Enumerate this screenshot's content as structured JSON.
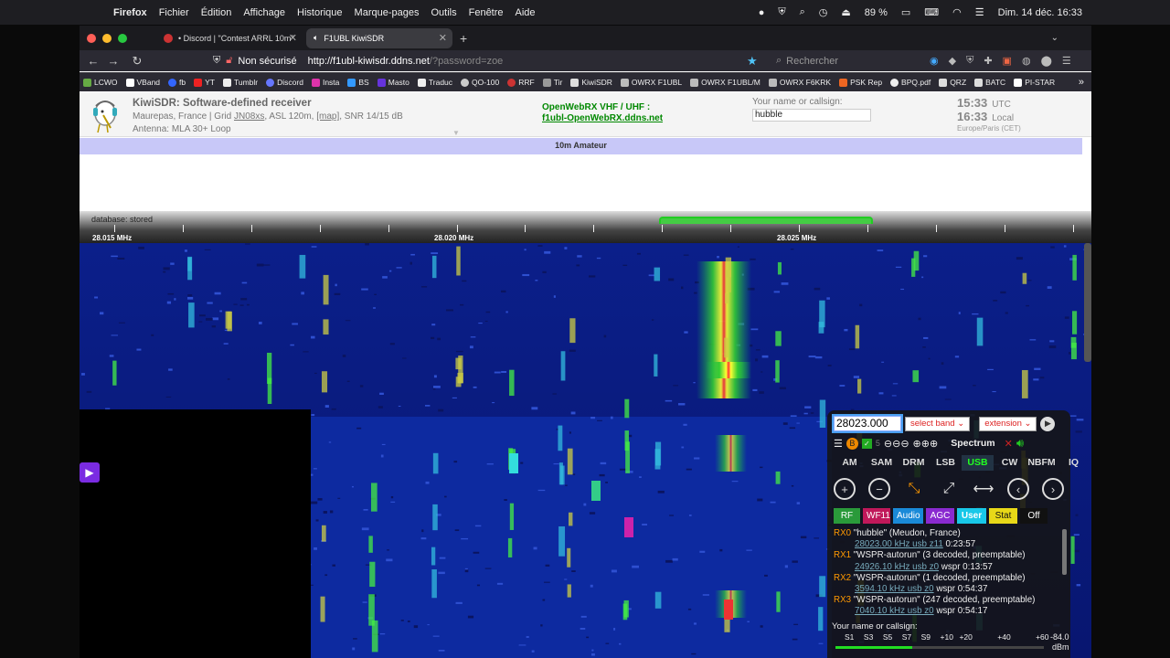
{
  "menubar": {
    "app": "Firefox",
    "items": [
      "Fichier",
      "Édition",
      "Affichage",
      "Historique",
      "Marque-pages",
      "Outils",
      "Fenêtre",
      "Aide"
    ],
    "battery": "89 %",
    "datetime": "Dim. 14 déc.  16:33"
  },
  "tabs": [
    {
      "label": "• Discord | \"Contest ARRL 10m\""
    },
    {
      "label": "F1UBL KiwiSDR"
    }
  ],
  "nav": {
    "security": "Non sécurisé",
    "url_host": "http://f1ubl-kiwisdr.ddns.net",
    "url_rest": "/?password=zoe",
    "search_placeholder": "Rechercher"
  },
  "bookmarks": [
    "LCWO",
    "VBand",
    "fb",
    "YT",
    "Tumblr",
    "Discord",
    "Insta",
    "BS",
    "Masto",
    "Traduc",
    "QO-100",
    "RRF",
    "Tir",
    "KiwiSDR",
    "OWRX F1UBL",
    "OWRX F1UBL/M",
    "OWRX F6KRK",
    "PSK Rep",
    "BPQ.pdf",
    "QRZ",
    "BATC",
    "PI-STAR"
  ],
  "kiwi": {
    "title": "KiwiSDR: Software-defined receiver",
    "location_prefix": "Maurepas, France | Grid ",
    "grid": "JN08xs",
    "location_mid": ", ASL 120m, ",
    "map": "[map]",
    "location_suffix": ", SNR 14/15 dB",
    "antenna": "Antenna: MLA 30+ Loop",
    "owrx_title": "OpenWebRX VHF / UHF :",
    "owrx_link": "f1ubl-OpenWebRX.ddns.net",
    "callsign_label": "Your name or callsign:",
    "callsign_value": "hubble",
    "utc_time": "15:33",
    "utc_label": "UTC",
    "local_time": "16:33",
    "local_label": "Local",
    "tz": "Europe/Paris (CET)"
  },
  "band_label": "10m Amateur",
  "scale": {
    "db": "database: stored",
    "labels": [
      "28.015 MHz",
      "28.020 MHz",
      "28.025 MHz"
    ]
  },
  "panel": {
    "frequency": "28023.000",
    "band_select": "select band",
    "ext_select": "extension",
    "spectrum": "Spectrum",
    "modes": [
      "AM",
      "SAM",
      "DRM",
      "LSB",
      "USB",
      "CW",
      "NBFM",
      "IQ"
    ],
    "active_mode": "USB",
    "tabs": [
      {
        "label": "RF",
        "color": "#2a9a3a"
      },
      {
        "label": "WF11",
        "color": "#c0185a"
      },
      {
        "label": "Audio",
        "color": "#1a8ad8"
      },
      {
        "label": "AGC",
        "color": "#8a2ad0"
      },
      {
        "label": "User",
        "color": "#18c8e8"
      },
      {
        "label": "Stat",
        "color": "#e8d818"
      },
      {
        "label": "Off",
        "color": "#111111"
      }
    ],
    "users": [
      {
        "rx": "RX0",
        "name": "\"hubble\" (Meudon, France)",
        "freq": "28023.00 kHz usb z11",
        "extra": " 0:23:57"
      },
      {
        "rx": "RX1",
        "name": "\"WSPR-autorun\" (3 decoded, preemptable)",
        "freq": "24926.10 kHz usb z0",
        "extra": " wspr 0:13:57"
      },
      {
        "rx": "RX2",
        "name": "\"WSPR-autorun\" (1 decoded, preemptable)",
        "freq": "3594.10 kHz usb z0",
        "extra": " wspr 0:54:37"
      },
      {
        "rx": "RX3",
        "name": "\"WSPR-autorun\" (247 decoded, preemptable)",
        "freq": "7040.10 kHz usb z0",
        "extra": " wspr 0:54:17"
      }
    ],
    "callsign_footer": "Your name or callsign:",
    "smeter_labels": [
      "S1",
      "S3",
      "S5",
      "S7",
      "S9",
      "+10",
      "+20",
      "",
      "+40",
      "",
      "+60"
    ],
    "smeter_value": "-84.0",
    "smeter_unit": "dBm",
    "smeter_level": 0.37
  }
}
